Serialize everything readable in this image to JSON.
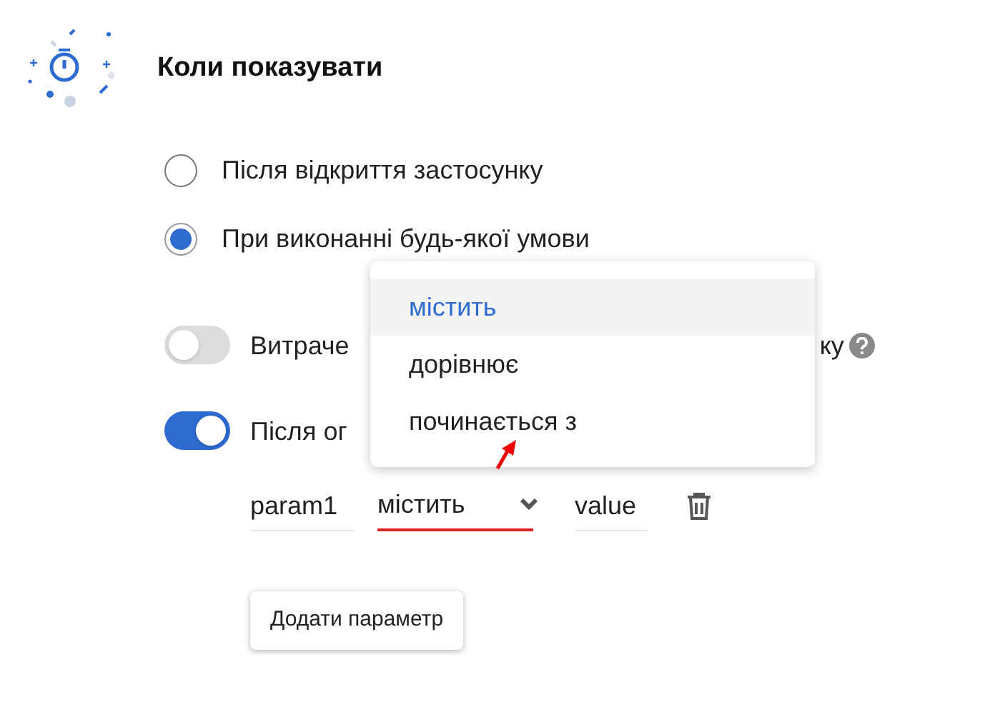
{
  "section": {
    "title": "Коли показувати"
  },
  "radios": [
    {
      "label": "Після відкриття застосунку",
      "selected": false
    },
    {
      "label": "При виконанні будь-якої умови",
      "selected": true
    }
  ],
  "toggles": [
    {
      "label_start": "Витраче",
      "label_end": "ку",
      "on": false,
      "help": true
    },
    {
      "label_start": "Після ог",
      "on": true,
      "help": false
    }
  ],
  "param": {
    "name": "param1",
    "operator": "містить",
    "value": "value"
  },
  "dropdown": {
    "options": [
      {
        "label": "містить",
        "selected": true
      },
      {
        "label": "дорівнює",
        "selected": false
      },
      {
        "label": "починається з",
        "selected": false
      }
    ]
  },
  "add_button": "Додати параметр"
}
